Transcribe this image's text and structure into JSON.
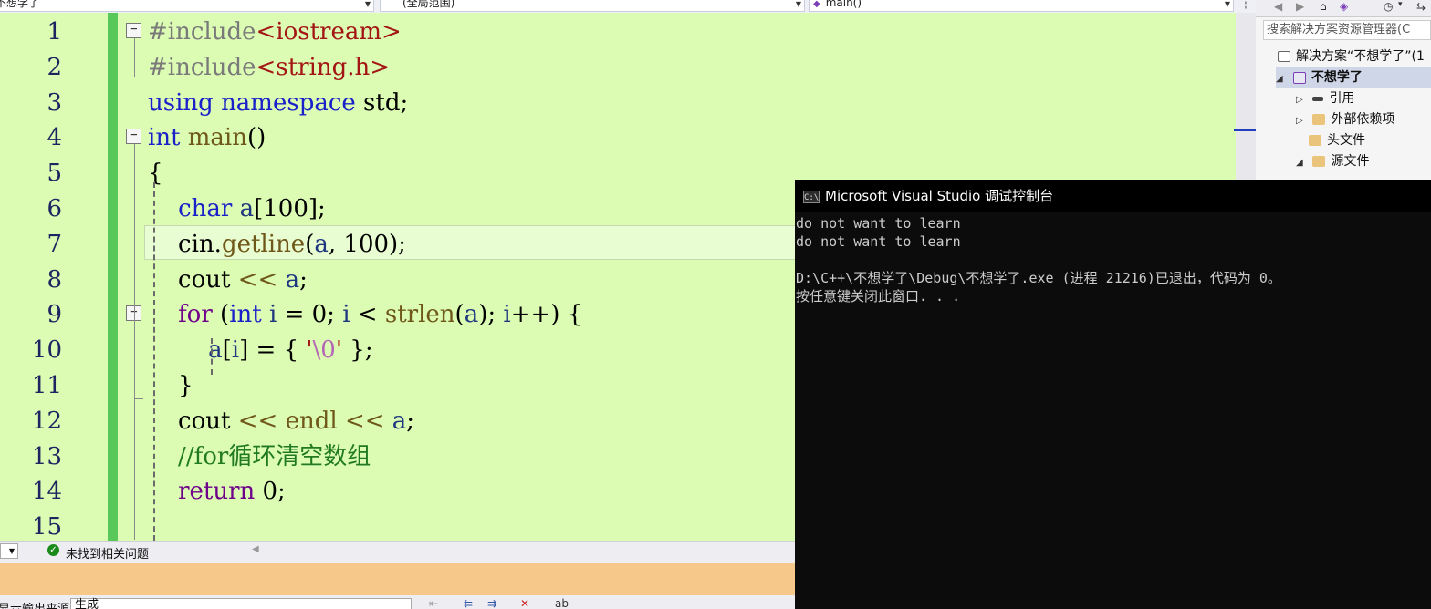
{
  "topbar": {
    "project_dropdown": "不想学了",
    "scope_dropdown": "(全局范围)",
    "function_dropdown": "main()"
  },
  "editor": {
    "line_numbers": [
      "1",
      "2",
      "3",
      "4",
      "5",
      "6",
      "7",
      "8",
      "9",
      "10",
      "11",
      "12",
      "13",
      "14",
      "15"
    ],
    "lines": [
      {
        "tokens": [
          {
            "t": "#include",
            "c": "pp"
          },
          {
            "t": "<iostream>",
            "c": "str"
          }
        ]
      },
      {
        "tokens": [
          {
            "t": "#include",
            "c": "pp"
          },
          {
            "t": "<string.h>",
            "c": "str"
          }
        ]
      },
      {
        "tokens": [
          {
            "t": "using",
            "c": "kw"
          },
          {
            "t": " ",
            "c": ""
          },
          {
            "t": "namespace",
            "c": "kw"
          },
          {
            "t": " std;",
            "c": ""
          }
        ]
      },
      {
        "tokens": [
          {
            "t": "int",
            "c": "kw"
          },
          {
            "t": " ",
            "c": ""
          },
          {
            "t": "main",
            "c": "fn"
          },
          {
            "t": "()",
            "c": ""
          }
        ]
      },
      {
        "tokens": [
          {
            "t": "{",
            "c": ""
          }
        ]
      },
      {
        "tokens": [
          {
            "t": "    ",
            "c": ""
          },
          {
            "t": "char",
            "c": "kw"
          },
          {
            "t": " ",
            "c": ""
          },
          {
            "t": "a",
            "c": "vr"
          },
          {
            "t": "[100];",
            "c": ""
          }
        ]
      },
      {
        "tokens": [
          {
            "t": "    cin.",
            "c": ""
          },
          {
            "t": "getline",
            "c": "fn"
          },
          {
            "t": "(",
            "c": ""
          },
          {
            "t": "a",
            "c": "vr"
          },
          {
            "t": ", 100);",
            "c": ""
          }
        ]
      },
      {
        "tokens": [
          {
            "t": "    cout ",
            "c": ""
          },
          {
            "t": "<<",
            "c": "fn"
          },
          {
            "t": " ",
            "c": ""
          },
          {
            "t": "a",
            "c": "vr"
          },
          {
            "t": ";",
            "c": ""
          }
        ]
      },
      {
        "tokens": [
          {
            "t": "    ",
            "c": ""
          },
          {
            "t": "for",
            "c": "mac"
          },
          {
            "t": " (",
            "c": ""
          },
          {
            "t": "int",
            "c": "kw"
          },
          {
            "t": " ",
            "c": ""
          },
          {
            "t": "i",
            "c": "vr"
          },
          {
            "t": " = 0; ",
            "c": ""
          },
          {
            "t": "i",
            "c": "vr"
          },
          {
            "t": " < ",
            "c": ""
          },
          {
            "t": "strlen",
            "c": "fn"
          },
          {
            "t": "(",
            "c": ""
          },
          {
            "t": "a",
            "c": "vr"
          },
          {
            "t": "); ",
            "c": ""
          },
          {
            "t": "i",
            "c": "vr"
          },
          {
            "t": "++) {",
            "c": ""
          }
        ]
      },
      {
        "tokens": [
          {
            "t": "        ",
            "c": ""
          },
          {
            "t": "a",
            "c": "vr"
          },
          {
            "t": "[",
            "c": ""
          },
          {
            "t": "i",
            "c": "vr"
          },
          {
            "t": "] = { ",
            "c": ""
          },
          {
            "t": "'",
            "c": "str"
          },
          {
            "t": "\\0",
            "c": "esc"
          },
          {
            "t": "'",
            "c": "str"
          },
          {
            "t": " };",
            "c": ""
          }
        ]
      },
      {
        "tokens": [
          {
            "t": "    }",
            "c": ""
          }
        ]
      },
      {
        "tokens": [
          {
            "t": "    cout ",
            "c": ""
          },
          {
            "t": "<<",
            "c": "fn"
          },
          {
            "t": " ",
            "c": ""
          },
          {
            "t": "endl",
            "c": "fn"
          },
          {
            "t": " ",
            "c": ""
          },
          {
            "t": "<<",
            "c": "fn"
          },
          {
            "t": " ",
            "c": ""
          },
          {
            "t": "a",
            "c": "vr"
          },
          {
            "t": ";",
            "c": ""
          }
        ]
      },
      {
        "tokens": [
          {
            "t": "    //for循环清空数组",
            "c": "cmt"
          }
        ]
      },
      {
        "tokens": [
          {
            "t": "    ",
            "c": ""
          },
          {
            "t": "return",
            "c": "mac"
          },
          {
            "t": " 0;",
            "c": ""
          }
        ]
      },
      {
        "tokens": [
          {
            "t": "",
            "c": ""
          }
        ]
      }
    ]
  },
  "solution_explorer": {
    "search_placeholder": "搜索解决方案资源管理器(C",
    "items": [
      {
        "label": "解决方案“不想学了”(1",
        "bold": false
      },
      {
        "label": "不想学了",
        "bold": true
      },
      {
        "label": "引用",
        "bold": false
      },
      {
        "label": "外部依赖项",
        "bold": false
      },
      {
        "label": "头文件",
        "bold": false
      },
      {
        "label": "源文件",
        "bold": false
      }
    ]
  },
  "console": {
    "title": "Microsoft Visual Studio 调试控制台",
    "icon_text": "C:\\",
    "lines": [
      "do not want to learn",
      "do not want to learn",
      "",
      "D:\\C++\\不想学了\\Debug\\不想学了.exe (进程 21216)已退出，代码为 0。",
      "按任意键关闭此窗口. . ."
    ]
  },
  "status": {
    "issues_text": "未找到相关问题"
  },
  "output": {
    "source_label": "显示输出来源(S):",
    "source_value": "生成"
  },
  "colors": {
    "editor_bg": "#dcfcb4",
    "console_bg": "#0c0c0c",
    "output_accent": "#f6c88a",
    "change_bar": "#58c85a"
  }
}
